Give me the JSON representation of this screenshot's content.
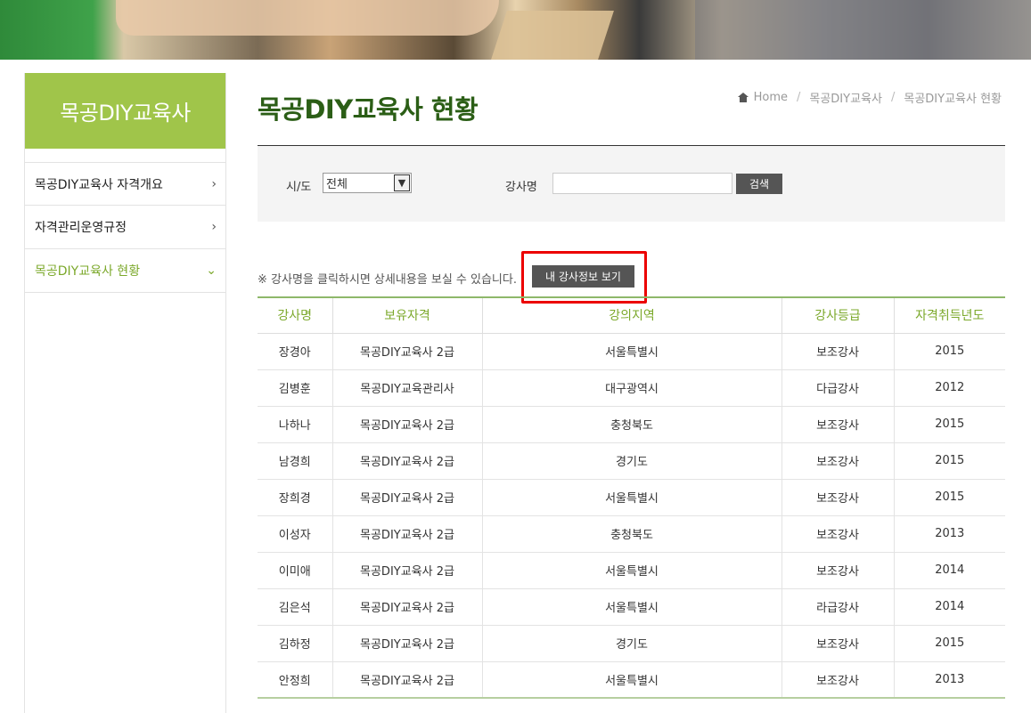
{
  "sidebar": {
    "title": "목공DIY교육사",
    "items": [
      {
        "label": "목공DIY교육사 자격개요",
        "active": false
      },
      {
        "label": "자격관리운영규정",
        "active": false
      },
      {
        "label": "목공DIY교육사 현황",
        "active": true
      }
    ]
  },
  "page": {
    "title": "목공DIY교육사 현황",
    "breadcrumb": [
      "Home",
      "목공DIY교육사",
      "목공DIY교육사 현황"
    ]
  },
  "search": {
    "region_label": "시/도",
    "region_selected": "전체",
    "name_label": "강사명",
    "name_value": "",
    "search_button": "검색"
  },
  "notice": {
    "text": "※ 강사명을 클릭하시면 상세내용을 보실 수 있습니다.",
    "my_info_button": "내 강사정보 보기"
  },
  "table": {
    "headers": [
      "강사명",
      "보유자격",
      "강의지역",
      "강사등급",
      "자격취득년도"
    ],
    "rows": [
      [
        "장경아",
        "목공DIY교육사 2급",
        "서울특별시",
        "보조강사",
        "2015"
      ],
      [
        "김병훈",
        "목공DIY교육관리사",
        "대구광역시",
        "다급강사",
        "2012"
      ],
      [
        "나하나",
        "목공DIY교육사 2급",
        "충청북도",
        "보조강사",
        "2015"
      ],
      [
        "남경희",
        "목공DIY교육사 2급",
        "경기도",
        "보조강사",
        "2015"
      ],
      [
        "장희경",
        "목공DIY교육사 2급",
        "서울특별시",
        "보조강사",
        "2015"
      ],
      [
        "이성자",
        "목공DIY교육사 2급",
        "충청북도",
        "보조강사",
        "2013"
      ],
      [
        "이미애",
        "목공DIY교육사 2급",
        "서울특별시",
        "보조강사",
        "2014"
      ],
      [
        "김은석",
        "목공DIY교육사 2급",
        "서울특별시",
        "라급강사",
        "2014"
      ],
      [
        "김하정",
        "목공DIY교육사 2급",
        "경기도",
        "보조강사",
        "2015"
      ],
      [
        "안정희",
        "목공DIY교육사 2급",
        "서울특별시",
        "보조강사",
        "2013"
      ]
    ]
  },
  "colors": {
    "accent_green": "#a0c54a",
    "title_green": "#2b5e16",
    "header_green": "#7ba82a",
    "highlight_red": "#ec0000"
  }
}
